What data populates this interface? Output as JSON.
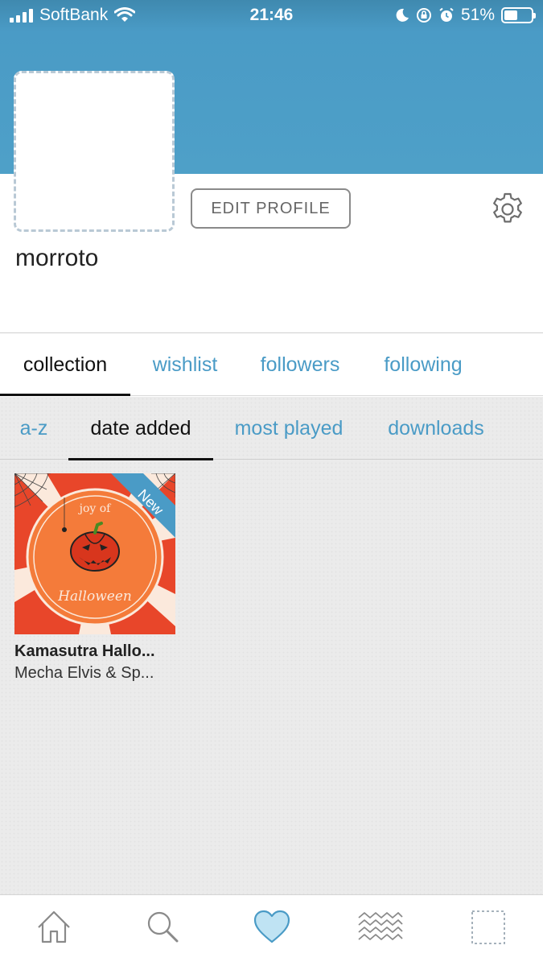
{
  "status_bar": {
    "carrier": "SoftBank",
    "time": "21:46",
    "battery_percent": "51%",
    "battery_level": 0.51
  },
  "profile": {
    "username": "morroto",
    "edit_button": "EDIT PROFILE"
  },
  "tabs": [
    {
      "label": "collection",
      "active": true
    },
    {
      "label": "wishlist",
      "active": false
    },
    {
      "label": "followers",
      "active": false
    },
    {
      "label": "following",
      "active": false
    }
  ],
  "sort_tabs": [
    {
      "label": "a-z",
      "active": false
    },
    {
      "label": "date added",
      "active": true
    },
    {
      "label": "most played",
      "active": false
    },
    {
      "label": "downloads",
      "active": false
    }
  ],
  "collection": [
    {
      "title": "Kamasutra Hallo...",
      "artist": "Mecha Elvis & Sp...",
      "badge": "New",
      "art_text_top": "joy of",
      "art_text_bottom": "Halloween"
    }
  ],
  "bottom_nav": [
    {
      "icon": "home-icon",
      "active": false
    },
    {
      "icon": "search-icon",
      "active": false
    },
    {
      "icon": "heart-icon",
      "active": true
    },
    {
      "icon": "feed-waves-icon",
      "active": false
    },
    {
      "icon": "profile-placeholder-icon",
      "active": false
    }
  ],
  "colors": {
    "accent": "#4a9bc6",
    "header": "#4ea0c8",
    "active_text": "#111111",
    "content_bg": "#ebebeb"
  }
}
